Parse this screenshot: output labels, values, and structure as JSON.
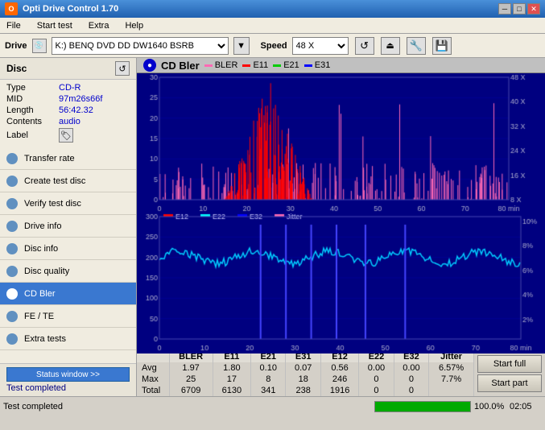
{
  "titleBar": {
    "title": "Opti Drive Control 1.70",
    "minBtn": "─",
    "maxBtn": "□",
    "closeBtn": "✕"
  },
  "menu": {
    "items": [
      "File",
      "Start test",
      "Extra",
      "Help"
    ]
  },
  "drive": {
    "label": "Drive",
    "driveValue": "K:) BENQ DVD DD DW1640 BSRB",
    "speedLabel": "Speed",
    "speedValue": "48 X"
  },
  "disc": {
    "sectionTitle": "Disc",
    "fields": [
      {
        "key": "Type",
        "value": "CD-R"
      },
      {
        "key": "MID",
        "value": "97m26s66f"
      },
      {
        "key": "Length",
        "value": "56:42.32"
      },
      {
        "key": "Contents",
        "value": "audio"
      },
      {
        "key": "Label",
        "value": ""
      }
    ]
  },
  "nav": {
    "items": [
      {
        "label": "Transfer rate",
        "active": false
      },
      {
        "label": "Create test disc",
        "active": false
      },
      {
        "label": "Verify test disc",
        "active": false
      },
      {
        "label": "Drive info",
        "active": false
      },
      {
        "label": "Disc info",
        "active": false
      },
      {
        "label": "Disc quality",
        "active": false
      },
      {
        "label": "CD Bler",
        "active": true
      },
      {
        "label": "FE / TE",
        "active": false
      },
      {
        "label": "Extra tests",
        "active": false
      }
    ]
  },
  "chart": {
    "title": "CD Bler",
    "icon": "cd-icon",
    "topLegend": [
      "BLER",
      "E11",
      "E21",
      "E31"
    ],
    "topLegendColors": [
      "#ff69b4",
      "#ff0000",
      "#00ff00",
      "#0000ff"
    ],
    "bottomLegend": [
      "E12",
      "E22",
      "E32",
      "Jitter"
    ],
    "bottomLegendColors": [
      "#ff0000",
      "#00ffff",
      "#0000ff",
      "#ff69b4"
    ],
    "topYMax": 30,
    "topRightLabel": "48 X",
    "bottomYMax": 300
  },
  "stats": {
    "headers": [
      "",
      "BLER",
      "E11",
      "E21",
      "E31",
      "E12",
      "E22",
      "E32",
      "Jitter"
    ],
    "rows": [
      {
        "label": "Avg",
        "values": [
          "1.97",
          "1.80",
          "0.10",
          "0.07",
          "0.56",
          "0.00",
          "0.00",
          "6.57%"
        ]
      },
      {
        "label": "Max",
        "values": [
          "25",
          "17",
          "8",
          "18",
          "246",
          "0",
          "0",
          "7.7%"
        ]
      },
      {
        "label": "Total",
        "values": [
          "6709",
          "6130",
          "341",
          "238",
          "1916",
          "0",
          "0",
          ""
        ]
      }
    ]
  },
  "buttons": {
    "startFull": "Start full",
    "startPart": "Start part"
  },
  "statusBar": {
    "statusWindowBtn": "Status window >>",
    "completedText": "Test completed",
    "progress": 100,
    "progressLabel": "100.0%",
    "timeLabel": "02:05"
  }
}
